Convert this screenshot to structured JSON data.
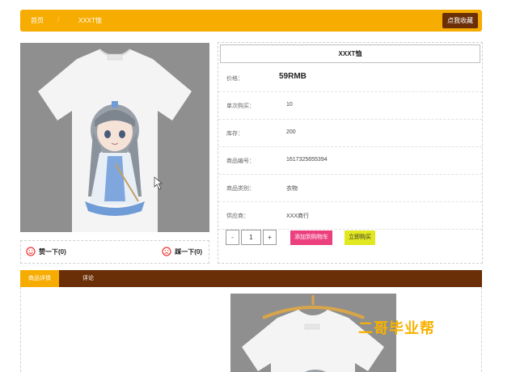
{
  "breadcrumb": {
    "home": "首页",
    "separator": "/",
    "current": "XXXT恤"
  },
  "header": {
    "favorite_label": "点我收藏"
  },
  "like_bar": {
    "like_label": "赞一下(0)",
    "dislike_label": "踩一下(0)"
  },
  "product": {
    "title": "XXXT恤",
    "fields": [
      {
        "label": "价格：",
        "value": "59RMB"
      },
      {
        "label": "单次购买：",
        "value": "10"
      },
      {
        "label": "库存：",
        "value": "200"
      },
      {
        "label": "商品编号：",
        "value": "1617325655394"
      },
      {
        "label": "商品类别：",
        "value": "衣物"
      },
      {
        "label": "供应商：",
        "value": "XXX商行"
      }
    ]
  },
  "purchase": {
    "minus": "-",
    "quantity": "1",
    "plus": "+",
    "add_to_cart": "添加到购物车",
    "buy_now": "立即购买"
  },
  "tabs": [
    {
      "label": "商品详情"
    },
    {
      "label": "评论"
    }
  ],
  "watermark": "二哥毕业帮",
  "colors": {
    "accent": "#f6ac00",
    "dark_brown": "#6b2f08",
    "cart_pink": "#ec3f7d",
    "buy_yellow": "#e2e81f"
  },
  "icons": {
    "like": "smile-icon",
    "dislike": "frown-icon"
  }
}
